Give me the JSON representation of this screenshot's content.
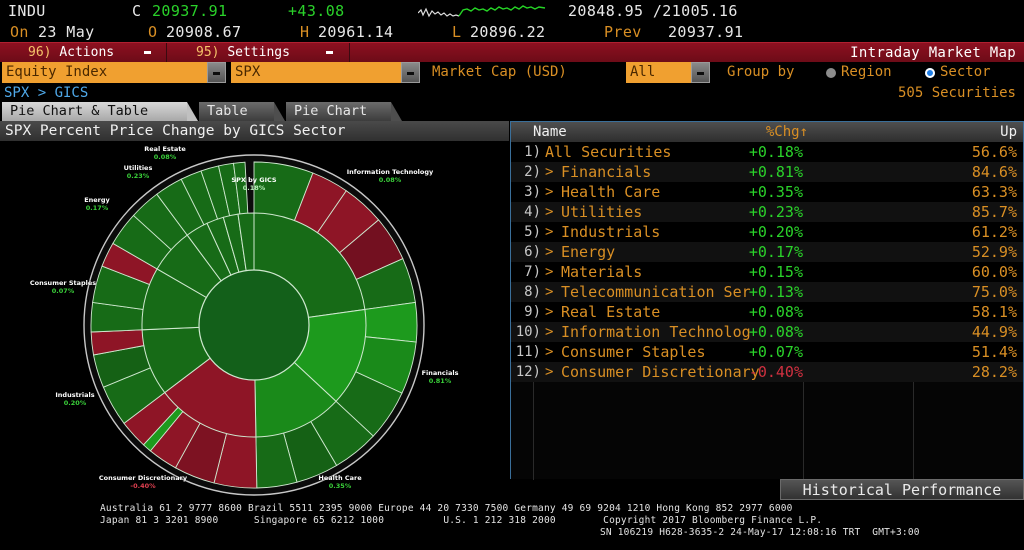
{
  "quote": {
    "ticker": "INDU",
    "last_prefix": "C",
    "last": "20937.91",
    "change": "+43.08",
    "range": "20848.95 /21005.16",
    "session_prefix": "On",
    "session_date": "23 May",
    "open_prefix": "O",
    "open": "20908.67",
    "high_prefix": "H",
    "high": "20961.14",
    "low_prefix": "L",
    "low": "20896.22",
    "prev_prefix": "Prev",
    "prev": "20937.91"
  },
  "actionbar": {
    "actions_num": "96)",
    "actions_label": "Actions",
    "settings_num": "95)",
    "settings_label": "Settings",
    "screen_title": "Intraday Market Map"
  },
  "filters": {
    "asset_class": "Equity Index",
    "ticker": "SPX",
    "market_cap_label": "Market Cap (USD)",
    "market_cap_value": "All",
    "group_by_label": "Group by",
    "group_region": "Region",
    "group_sector": "Sector",
    "group_selected": "Sector"
  },
  "breadcrumb": "SPX > GICS",
  "securities_count": "505 Securities",
  "tabs": [
    {
      "label": "Pie Chart & Table",
      "active": true
    },
    {
      "label": "Table",
      "active": false
    },
    {
      "label": "Pie Chart",
      "active": false
    }
  ],
  "chart_title": "SPX Percent Price Change by GICS Sector",
  "table": {
    "columns": [
      "Name",
      "%Chg",
      "Up"
    ],
    "sort_column": "%Chg",
    "sort_dir": "↑",
    "rows": [
      {
        "idx": "1)",
        "arrow": "",
        "name": "All Securities",
        "chg": "+0.18%",
        "chg_sign": "up",
        "up": "56.6%"
      },
      {
        "idx": "2)",
        "arrow": ">",
        "name": "Financials",
        "chg": "+0.81%",
        "chg_sign": "up",
        "up": "84.6%"
      },
      {
        "idx": "3)",
        "arrow": ">",
        "name": "Health Care",
        "chg": "+0.35%",
        "chg_sign": "up",
        "up": "63.3%"
      },
      {
        "idx": "4)",
        "arrow": ">",
        "name": "Utilities",
        "chg": "+0.23%",
        "chg_sign": "up",
        "up": "85.7%"
      },
      {
        "idx": "5)",
        "arrow": ">",
        "name": "Industrials",
        "chg": "+0.20%",
        "chg_sign": "up",
        "up": "61.2%"
      },
      {
        "idx": "6)",
        "arrow": ">",
        "name": "Energy",
        "chg": "+0.17%",
        "chg_sign": "up",
        "up": "52.9%"
      },
      {
        "idx": "7)",
        "arrow": ">",
        "name": "Materials",
        "chg": "+0.15%",
        "chg_sign": "up",
        "up": "60.0%"
      },
      {
        "idx": "8)",
        "arrow": ">",
        "name": "Telecommunication Ser",
        "chg": "+0.13%",
        "chg_sign": "up",
        "up": "75.0%"
      },
      {
        "idx": "9)",
        "arrow": ">",
        "name": "Real Estate",
        "chg": "+0.08%",
        "chg_sign": "up",
        "up": "58.1%"
      },
      {
        "idx": "10)",
        "arrow": ">",
        "name": "Information Technolog",
        "chg": "+0.08%",
        "chg_sign": "up",
        "up": "44.9%"
      },
      {
        "idx": "11)",
        "arrow": ">",
        "name": "Consumer Staples",
        "chg": "+0.07%",
        "chg_sign": "up",
        "up": "51.4%"
      },
      {
        "idx": "12)",
        "arrow": ">",
        "name": "Consumer Discretionary",
        "chg": "-0.40%",
        "chg_sign": "down",
        "up": "28.2%"
      }
    ]
  },
  "historical_button": "Historical Performance",
  "footer": {
    "line1": "Australia 61 2 9777 8600 Brazil 5511 2395 9000 Europe 44 20 7330 7500 Germany 49 69 9204 1210 Hong Kong 852 2977 6000",
    "line2": "Japan 81 3 3201 8900      Singapore 65 6212 1000          U.S. 1 212 318 2000        Copyright 2017 Bloomberg Finance L.P.",
    "line3": "SN 106219 H628-3635-2 24-May-17 12:08:16 TRT  GMT+3:00"
  },
  "colors": {
    "accent_amber": "#d98f24",
    "up_green": "#2ad22a",
    "down_red": "#d03040",
    "brand_red": "#8d1020",
    "dropdown": "#f0a030",
    "link_blue": "#4fa8e8"
  },
  "chart_data": {
    "type": "pie",
    "title": "SPX Percent Price Change by GICS Sector",
    "center_label": "SPX by GICS",
    "center_value": "0.18%",
    "legend_position": "around-slices",
    "value_unit": "percent price change",
    "categories": [
      "Information Technology",
      "Financials",
      "Health Care",
      "Consumer Discretionary",
      "Industrials",
      "Consumer Staples",
      "Energy",
      "Utilities",
      "Real Estate",
      "Materials",
      "Telecommunication Services"
    ],
    "values": [
      0.08,
      0.81,
      0.35,
      -0.4,
      0.2,
      0.07,
      0.17,
      0.23,
      0.08,
      0.15,
      0.13
    ],
    "weights": [
      22.5,
      14.2,
      14.5,
      12.3,
      10.2,
      9.2,
      6.3,
      3.2,
      3.0,
      2.9,
      2.1
    ],
    "labels": [
      {
        "name": "Information Technology",
        "value": "0.08%",
        "sign": "up"
      },
      {
        "name": "Financials",
        "value": "0.81%",
        "sign": "up"
      },
      {
        "name": "Health Care",
        "value": "0.35%",
        "sign": "up"
      },
      {
        "name": "Consumer Discretionary",
        "value": "-0.40%",
        "sign": "down"
      },
      {
        "name": "Industrials",
        "value": "0.20%",
        "sign": "up"
      },
      {
        "name": "Consumer Staples",
        "value": "0.07%",
        "sign": "up"
      },
      {
        "name": "Energy",
        "value": "0.17%",
        "sign": "up"
      },
      {
        "name": "Utilities",
        "value": "0.23%",
        "sign": "up"
      },
      {
        "name": "Real Estate",
        "value": "0.08%",
        "sign": "up"
      }
    ]
  }
}
